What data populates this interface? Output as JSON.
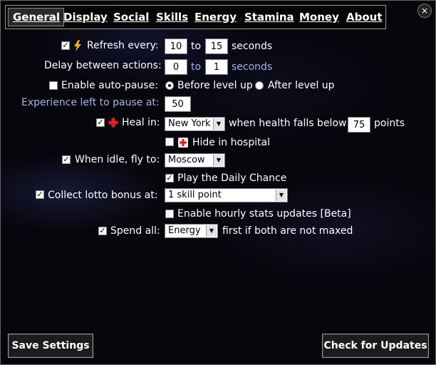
{
  "close": {
    "glyph": "×"
  },
  "tabs": [
    "General",
    "Display",
    "Social",
    "Skills",
    "Energy",
    "Stamina",
    "Money",
    "About"
  ],
  "refresh": {
    "checked": true,
    "label": "Refresh every:",
    "from": "10",
    "to_word": "to",
    "to": "15",
    "unit": "seconds"
  },
  "delay": {
    "label": "Delay between actions:",
    "from": "0",
    "to_word": "to",
    "to": "1",
    "unit": "seconds"
  },
  "autopause": {
    "checked": false,
    "label": "Enable auto-pause:",
    "opt1": "Before level up",
    "opt2": "After level up",
    "selected": "opt1"
  },
  "exp": {
    "label": "Experience left to pause at:",
    "value": "50"
  },
  "heal": {
    "checked": true,
    "label": "Heal in:",
    "city": "New York",
    "mid": "when health falls below",
    "value": "75",
    "unit": "points"
  },
  "hospital": {
    "checked": false,
    "label": "Hide in hospital"
  },
  "idle": {
    "checked": true,
    "label": "When idle, fly to:",
    "city": "Moscow"
  },
  "daily": {
    "checked": true,
    "label": "Play the Daily Chance"
  },
  "lotto": {
    "checked": true,
    "label": "Collect lotto bonus at:",
    "value": "1 skill point"
  },
  "hourly": {
    "checked": false,
    "label": "Enable hourly stats updates [Beta]"
  },
  "spend": {
    "checked": true,
    "label": "Spend all:",
    "value": "Energy",
    "suffix": "first if both are not maxed"
  },
  "buttons": {
    "save": "Save Settings",
    "check": "Check for Updates"
  },
  "colors": {
    "background": "#06060c",
    "accent_text": "#a8b4e8",
    "heal_cross": "#d8202a",
    "lightning": "#f2b21a"
  },
  "icons": {
    "refresh": "lightning-icon",
    "heal": "red-cross-icon",
    "hospital": "hospital-icon"
  }
}
